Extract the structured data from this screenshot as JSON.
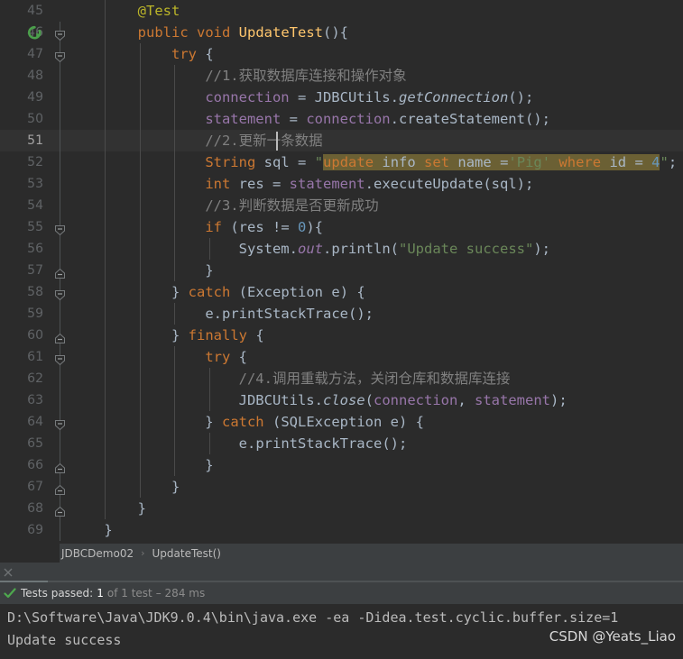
{
  "editor": {
    "first_line": 45,
    "current_line": 51,
    "lines": [
      {
        "n": 45,
        "indent": 2,
        "fold": "none",
        "text": "@Test"
      },
      {
        "n": 46,
        "indent": 2,
        "fold": "open",
        "text": "public void UpdateTest(){",
        "run_icon": "run-test-icon"
      },
      {
        "n": 47,
        "indent": 3,
        "fold": "open",
        "text": "try {"
      },
      {
        "n": 48,
        "indent": 4,
        "fold": "none",
        "text": "//1.获取数据库连接和操作对象"
      },
      {
        "n": 49,
        "indent": 4,
        "fold": "none",
        "text": "connection = JDBCUtils.getConnection();"
      },
      {
        "n": 50,
        "indent": 4,
        "fold": "none",
        "text": "statement = connection.createStatement();"
      },
      {
        "n": 51,
        "indent": 4,
        "fold": "none",
        "text": "//2.更新一条数据"
      },
      {
        "n": 52,
        "indent": 4,
        "fold": "none",
        "text": "String sql = \"update info set name ='Pig' where id = 4\";"
      },
      {
        "n": 53,
        "indent": 4,
        "fold": "none",
        "text": "int res = statement.executeUpdate(sql);"
      },
      {
        "n": 54,
        "indent": 4,
        "fold": "none",
        "text": "//3.判断数据是否更新成功"
      },
      {
        "n": 55,
        "indent": 4,
        "fold": "open",
        "text": "if (res != 0){"
      },
      {
        "n": 56,
        "indent": 5,
        "fold": "none",
        "text": "System.out.println(\"Update success\");"
      },
      {
        "n": 57,
        "indent": 4,
        "fold": "close",
        "text": "}"
      },
      {
        "n": 58,
        "indent": 3,
        "fold": "open",
        "text": "} catch (Exception e) {"
      },
      {
        "n": 59,
        "indent": 4,
        "fold": "none",
        "text": "e.printStackTrace();"
      },
      {
        "n": 60,
        "indent": 3,
        "fold": "close",
        "text": "} finally {"
      },
      {
        "n": 61,
        "indent": 4,
        "fold": "open",
        "text": "try {"
      },
      {
        "n": 62,
        "indent": 5,
        "fold": "none",
        "text": "//4.调用重载方法，关闭仓库和数据库连接"
      },
      {
        "n": 63,
        "indent": 5,
        "fold": "none",
        "text": "JDBCUtils.close(connection, statement);"
      },
      {
        "n": 64,
        "indent": 4,
        "fold": "open",
        "text": "} catch (SQLException e) {"
      },
      {
        "n": 65,
        "indent": 5,
        "fold": "none",
        "text": "e.printStackTrace();"
      },
      {
        "n": 66,
        "indent": 4,
        "fold": "close",
        "text": "}"
      },
      {
        "n": 67,
        "indent": 3,
        "fold": "close",
        "text": "}"
      },
      {
        "n": 68,
        "indent": 2,
        "fold": "close",
        "text": "}"
      },
      {
        "n": 69,
        "indent": 1,
        "fold": "none",
        "text": "}"
      }
    ],
    "sql_injection": "update info set name ='Pig' where id = 4",
    "caret_line": 51
  },
  "breadcrumb": {
    "class_name": "JDBCDemo02",
    "separator": "›",
    "method_name": "UpdateTest()"
  },
  "run_window": {
    "close_icon": "close-icon",
    "progress_percent": 7,
    "status": {
      "icon": "check-mark-icon",
      "label": "Tests passed:",
      "count": "1",
      "detail": "of 1 test",
      "duration": "– 284 ms"
    },
    "console": {
      "line1": "D:\\Software\\Java\\JDK9.0.4\\bin\\java.exe -ea -Didea.test.cyclic.buffer.size=1",
      "line2": "Update success"
    },
    "watermark": "CSDN @Yeats_Liao"
  },
  "colors": {
    "editor_bg": "#2b2b2b",
    "panel_bg": "#3c3f41",
    "keyword": "#cc7832",
    "string": "#6a8759",
    "comment": "#808080",
    "field": "#9876aa",
    "method": "#ffc66d",
    "number": "#6897bb",
    "annotation": "#bbb529",
    "default_text": "#a9b7c6",
    "sql_highlight": "#6b6034",
    "success_green": "#5a9e4b"
  }
}
